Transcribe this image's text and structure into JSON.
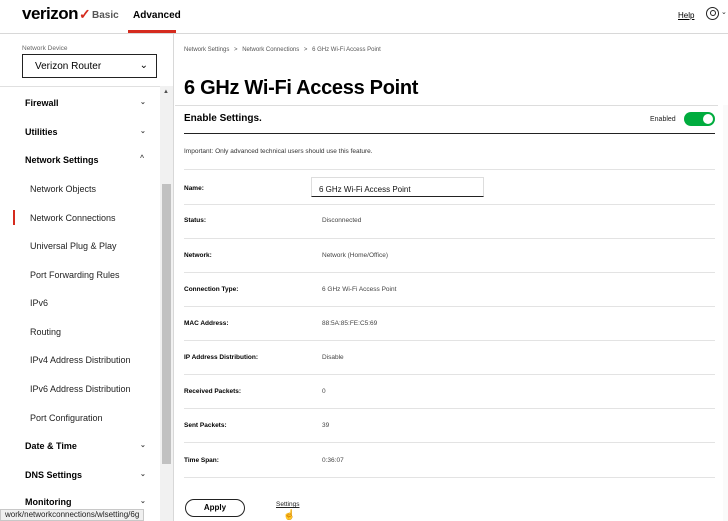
{
  "topbar": {
    "logo": "verizon",
    "logo_check": "✓",
    "tabs": [
      "Basic",
      "Advanced"
    ],
    "active_tab": "Advanced",
    "help": "Help",
    "user_caret": "⌄"
  },
  "sidebar": {
    "device_label": "Network Device",
    "device_value": "Verizon Router",
    "device_caret": "⌄",
    "items": [
      {
        "label": "Firewall",
        "chevron": "⌄"
      },
      {
        "label": "Utilities",
        "chevron": "⌄"
      },
      {
        "label": "Network Settings",
        "chevron": "^"
      },
      {
        "label": "Network Objects"
      },
      {
        "label": "Network Connections"
      },
      {
        "label": "Universal Plug & Play"
      },
      {
        "label": "Port Forwarding Rules"
      },
      {
        "label": "IPv6"
      },
      {
        "label": "Routing"
      },
      {
        "label": "IPv4 Address Distribution"
      },
      {
        "label": "IPv6 Address Distribution"
      },
      {
        "label": "Port Configuration"
      },
      {
        "label": "Date & Time",
        "chevron": "⌄"
      },
      {
        "label": "DNS Settings",
        "chevron": "⌄"
      },
      {
        "label": "Monitoring",
        "chevron": "⌄"
      }
    ],
    "scroll_up": "▲",
    "status_url": "work/networkconnections/wlsetting/6g"
  },
  "main": {
    "breadcrumb": [
      "Network Settings",
      ">",
      "Network Connections",
      ">",
      "6 GHz Wi-Fi Access Point"
    ],
    "title": "6 GHz Wi-Fi Access Point",
    "section_title": "Enable Settings.",
    "enabled_label": "Enabled",
    "enabled": true,
    "notice": "Important: Only advanced technical users should use this feature.",
    "fields": [
      {
        "label": "Name:",
        "value": "6 GHz Wi-Fi Access Point"
      },
      {
        "label": "Status:",
        "value": "Disconnected"
      },
      {
        "label": "Network:",
        "value": "Network (Home/Office)"
      },
      {
        "label": "Connection Type:",
        "value": "6 GHz Wi-Fi Access Point"
      },
      {
        "label": "MAC Address:",
        "value": "88:5A:85:FE:C5:69"
      },
      {
        "label": "IP Address Distribution:",
        "value": "Disable"
      },
      {
        "label": "Received Packets:",
        "value": "0"
      },
      {
        "label": "Sent Packets:",
        "value": "39"
      },
      {
        "label": "Time Span:",
        "value": "0:36:07"
      }
    ],
    "apply": "Apply",
    "settings": "Settings"
  },
  "colors": {
    "brand_red": "#d52b1e",
    "toggle_green": "#00ac3e"
  }
}
